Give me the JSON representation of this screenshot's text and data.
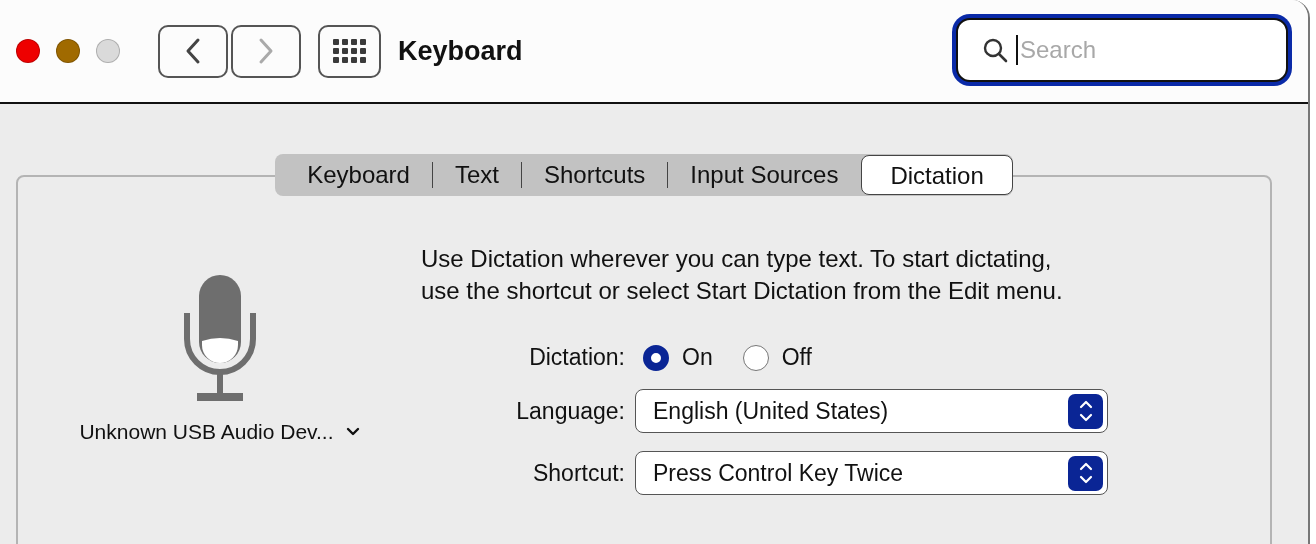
{
  "window": {
    "title": "Keyboard",
    "traffic_lights": [
      {
        "color": "#ee0000"
      },
      {
        "color": "#a06a00"
      },
      {
        "color": "#dadada"
      }
    ],
    "nav_buttons": [
      {
        "kind": "back",
        "disabled": false
      },
      {
        "kind": "forward",
        "disabled": true
      }
    ],
    "search": {
      "placeholder": "Search",
      "focused": true
    }
  },
  "tabs": [
    {
      "label": "Keyboard",
      "selected": false
    },
    {
      "label": "Text",
      "selected": false
    },
    {
      "label": "Shortcuts",
      "selected": false
    },
    {
      "label": "Input Sources",
      "selected": false
    },
    {
      "label": "Dictation",
      "selected": true
    }
  ],
  "dictation": {
    "description": "Use Dictation wherever you can type text. To start dictating, use the shortcut or select Start Dictation from the Edit menu.",
    "input_device": "Unknown USB Audio Dev...",
    "label": "Dictation:",
    "options": [
      {
        "label": "On",
        "selected": true
      },
      {
        "label": "Off",
        "selected": false
      }
    ],
    "popups": [
      {
        "label": "Language:",
        "value": "English (United States)"
      },
      {
        "label": "Shortcut:",
        "value": "Press Control Key Twice"
      }
    ]
  }
}
